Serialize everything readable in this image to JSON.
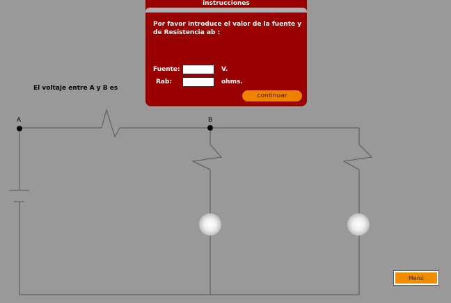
{
  "dialog": {
    "title": "instrucciones",
    "prompt": "Por favor introduce el valor de la fuente y de Resistencia ab :",
    "source_label": "Fuente:",
    "source_value": "",
    "source_unit": "V.",
    "resistance_label": "Rab:",
    "resistance_value": "",
    "resistance_unit": "ohms.",
    "continue_label": "continuar"
  },
  "question": "El voltaje entre A y B es",
  "nodes": {
    "a": "A",
    "b": "B"
  },
  "menu_label": "Menú",
  "colors": {
    "background": "#999999",
    "dialog": "#990000",
    "button": "#f08000",
    "wire": "#555555"
  }
}
